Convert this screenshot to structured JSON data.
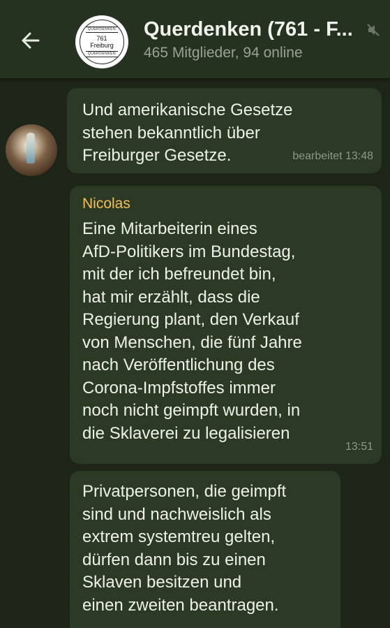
{
  "header": {
    "back_icon": "arrow-left-icon",
    "group_logo": {
      "top": "QUERDENKEN",
      "number": "761",
      "city": "Freiburg",
      "bottom": "QUERDENKEN"
    },
    "title": "Querdenken (761 - F...",
    "subtitle": "465 Mitglieder, 94 online",
    "mute_icon": "muted-speaker-icon"
  },
  "messages": [
    {
      "text": "Und amerikanische Gesetze\nstehen bekanntlich über\nFreiburger Gesetze.",
      "time": "bearbeitet 13:48"
    },
    {
      "sender": "Nicolas",
      "text": "Eine Mitarbeiterin eines\nAfD-Politikers im Bundestag,\nmit der ich befreundet bin,\nhat mir erzählt, dass die\nRegierung plant, den Verkauf\nvon Menschen, die fünf Jahre\nnach Veröffentlichung des\nCorona-Impfstoffes immer\nnoch nicht geimpft wurden, in\ndie Sklaverei zu legalisieren",
      "time": "13:51"
    },
    {
      "text": "Privatpersonen, die geimpft\nsind und nachweislich als\nextrem systemtreu gelten,\ndürfen dann bis zu einen\nSklaven besitzen und\neinen zweiten beantragen."
    }
  ],
  "colors": {
    "background": "#1d2518",
    "header": "#263220",
    "bubble": "#2c3924",
    "sender_name": "#f0c058"
  }
}
